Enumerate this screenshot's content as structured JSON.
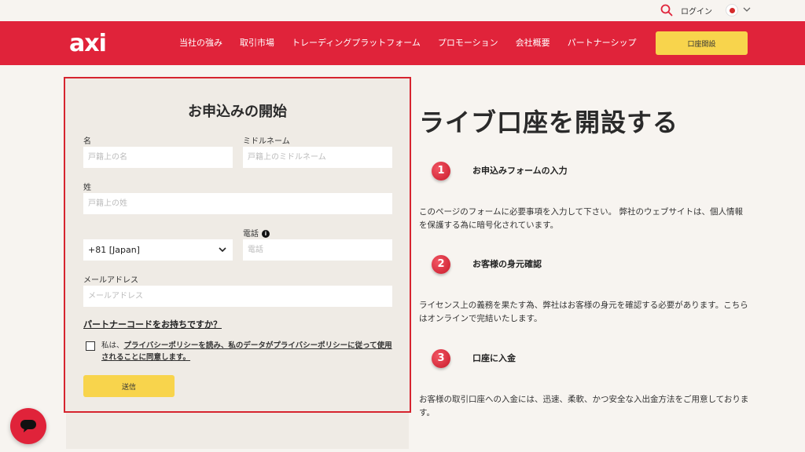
{
  "topbar": {
    "login_label": "ログイン"
  },
  "nav": {
    "logo": "axi",
    "links": [
      "当社の強み",
      "取引市場",
      "トレーディングプラットフォーム",
      "プロモーション",
      "会社概要",
      "パートナーシップ"
    ],
    "open_account_label": "口座開設"
  },
  "form": {
    "title": "お申込みの開始",
    "first_name_label": "名",
    "first_name_placeholder": "戸籍上の名",
    "middle_name_label": "ミドルネーム",
    "middle_name_placeholder": "戸籍上のミドルネーム",
    "last_name_label": "姓",
    "last_name_placeholder": "戸籍上の姓",
    "country_code_value": "+81 [Japan]",
    "phone_label": "電話",
    "phone_placeholder": "電話",
    "email_label": "メールアドレス",
    "email_placeholder": "メールアドレス",
    "partner_code_link": "パートナーコードをお持ちですか？",
    "consent_prefix": "私は、",
    "consent_link": "プライバシーポリシーを読み、私のデータがプライバシーポリシーに従って使用されることに同意します。",
    "submit_label": "送信"
  },
  "main": {
    "heading": "ライブ口座を開設する",
    "steps": [
      {
        "number": "1",
        "title": "お申込みフォームの入力",
        "description": "このページのフォームに必要事項を入力して下さい。 弊社のウェブサイトは、個人情報を保護する為に暗号化されています。"
      },
      {
        "number": "2",
        "title": "お客様の身元確認",
        "description": "ライセンス上の義務を果たす為、弊社はお客様の身元を確認する必要があります。こちらはオンラインで完結いたします。"
      },
      {
        "number": "3",
        "title": "口座に入金",
        "description": "お客様の取引口座への入金には、迅速、柔軟、かつ安全な入出金方法をご用意しております。"
      }
    ]
  },
  "colors": {
    "brand_red": "#e0233a",
    "button_yellow": "#f8d44c",
    "background": "#f7f4f0",
    "panel": "#efebe5"
  }
}
